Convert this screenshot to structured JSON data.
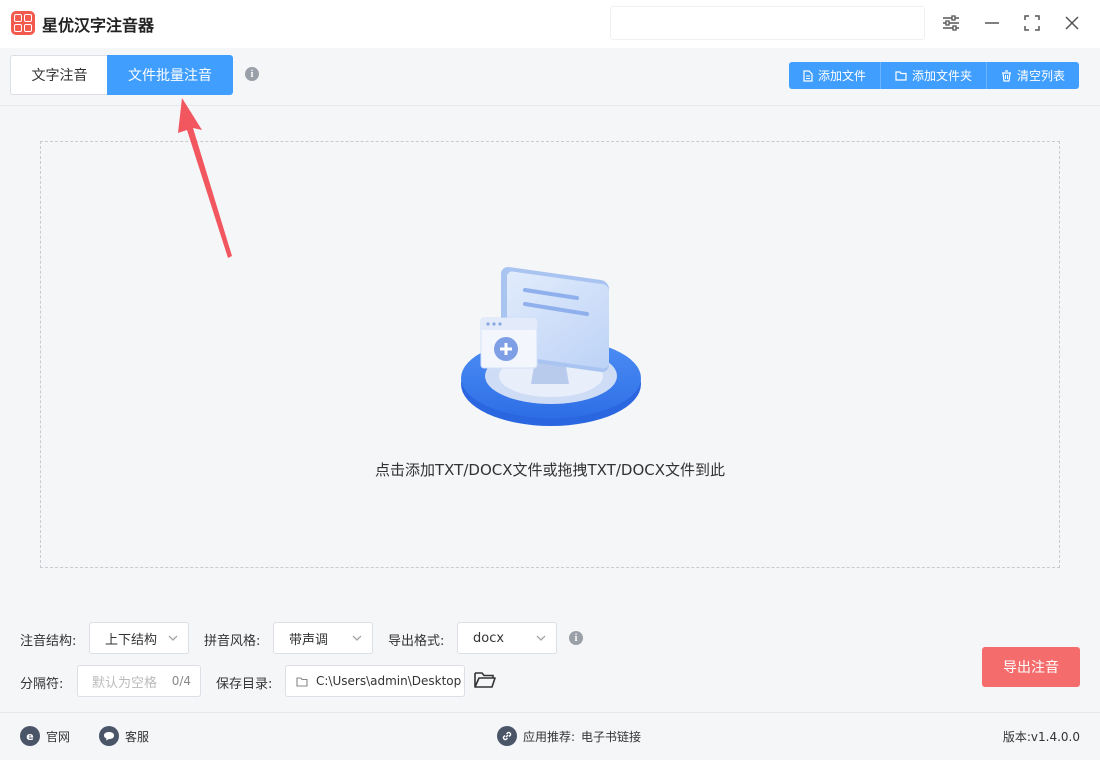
{
  "app": {
    "title": "星优汉字注音器"
  },
  "tabs": [
    {
      "label": "文字注音",
      "active": false
    },
    {
      "label": "文件批量注音",
      "active": true
    }
  ],
  "toolbar": {
    "add_file": "添加文件",
    "add_folder": "添加文件夹",
    "clear_list": "清空列表"
  },
  "dropzone": {
    "hint": "点击添加TXT/DOCX文件或拖拽TXT/DOCX文件到此"
  },
  "options": {
    "structure_label": "注音结构:",
    "structure_value": "上下结构",
    "style_label": "拼音风格:",
    "style_value": "带声调",
    "format_label": "导出格式:",
    "format_value": "docx",
    "separator_label": "分隔符:",
    "separator_placeholder": "默认为空格",
    "separator_count": "0/4",
    "save_dir_label": "保存目录:",
    "save_dir_value": "C:\\Users\\admin\\Desktop"
  },
  "export_button": "导出注音",
  "footer": {
    "website": "官网",
    "support": "客服",
    "recommend_label": "应用推荐:",
    "recommend_value": "电子书链接",
    "version": "版本:v1.4.0.0"
  },
  "colors": {
    "primary": "#409eff",
    "danger": "#f56c6c",
    "logo": "#f25a4d",
    "arrow": "#f2565f"
  },
  "icons": [
    "app-logo-icon",
    "settings-icon",
    "minimize-icon",
    "maximize-icon",
    "close-icon",
    "info-icon",
    "file-icon",
    "folder-icon",
    "trash-icon",
    "chevron-down-icon",
    "folder-open-icon",
    "ie-icon",
    "chat-icon",
    "link-icon"
  ]
}
